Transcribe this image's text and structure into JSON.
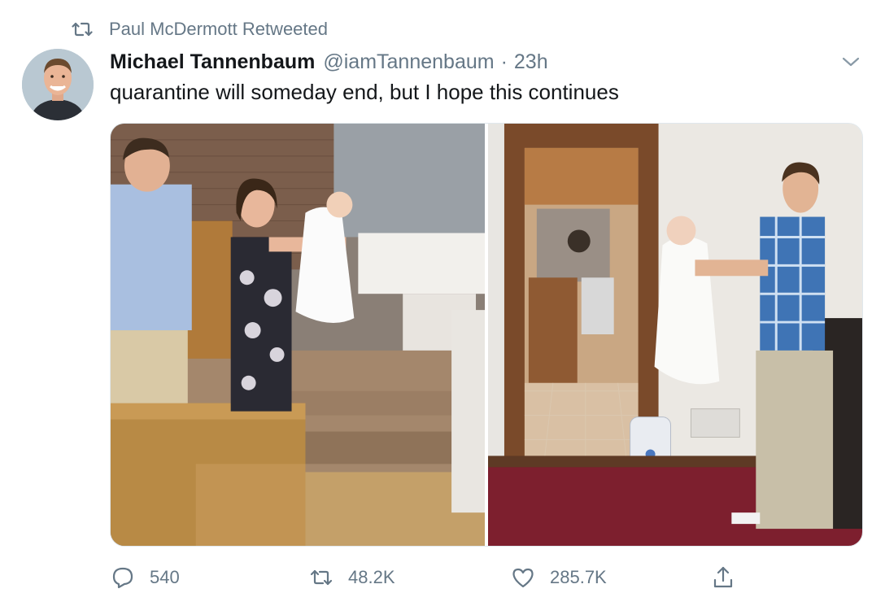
{
  "retweet_banner": {
    "text": "Paul McDermott Retweeted",
    "icon": "retweet-icon"
  },
  "tweet": {
    "author_name": "Michael Tannenbaum",
    "handle": "@iamTannenbaum",
    "separator": "·",
    "time": "23h",
    "text": "quarantine will someday end, but I hope this continues",
    "menu_icon": "chevron-down-icon"
  },
  "media": {
    "photos": [
      {
        "icon": "church-baptism-photo"
      },
      {
        "icon": "home-baby-lift-photo"
      }
    ]
  },
  "actions": {
    "reply_count": "540",
    "retweet_count": "48.2K",
    "like_count": "285.7K"
  },
  "colors": {
    "text_primary": "#14171a",
    "text_secondary": "#657786",
    "border": "#e1e8ed"
  }
}
